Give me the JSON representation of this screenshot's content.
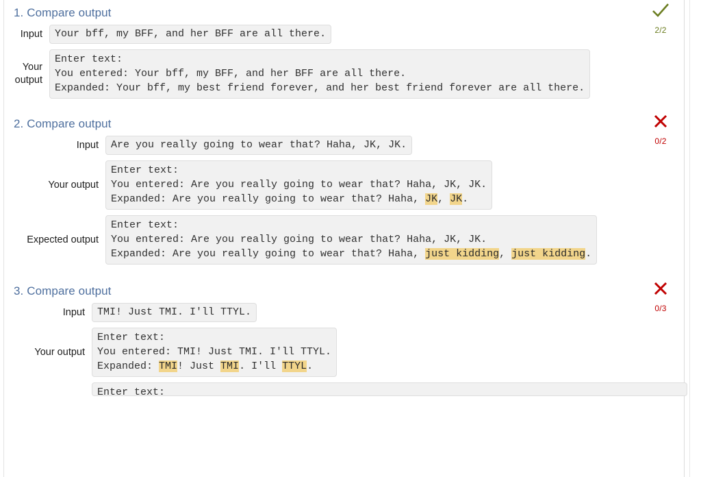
{
  "labels": {
    "input": "Input",
    "your_output": "Your output",
    "expected_output": "Expected output"
  },
  "sections": [
    {
      "title": "1. Compare output",
      "status_icon": "check-icon",
      "status": "pass",
      "score": "2/2",
      "input": "Your bff, my BFF, and her BFF are all there.",
      "your_output": {
        "line1": "Enter text:",
        "line2": "You entered: Your bff, my BFF, and her BFF are all there.",
        "line3": "Expanded: Your bff, my best friend forever, and her best friend forever are all there."
      }
    },
    {
      "title": "2. Compare output",
      "status_icon": "cross-icon",
      "status": "fail",
      "score": "0/2",
      "input": "Are you really going to wear that? Haha, JK, JK.",
      "your_output": {
        "line1": "Enter text:",
        "line2": "You entered: Are you really going to wear that? Haha, JK, JK.",
        "line3_prefix": "Expanded: Are you really going to wear that? Haha, ",
        "line3_hl1": "JK",
        "line3_mid": ", ",
        "line3_hl2": "JK",
        "line3_suffix": "."
      },
      "expected_output": {
        "line1": "Enter text:",
        "line2": "You entered: Are you really going to wear that? Haha, JK, JK.",
        "line3_prefix": "Expanded: Are you really going to wear that? Haha, ",
        "line3_hl1": "just kidding",
        "line3_mid": ", ",
        "line3_hl2": "just kidding",
        "line3_suffix": "."
      }
    },
    {
      "title": "3. Compare output",
      "status_icon": "cross-icon",
      "status": "fail",
      "score": "0/3",
      "input": "TMI! Just TMI. I'll TTYL.",
      "your_output": {
        "line1": "Enter text:",
        "line2": "You entered: TMI! Just TMI. I'll TTYL.",
        "line3_prefix": "Expanded: ",
        "line3_hl1": "TMI",
        "line3_mid1": "! Just ",
        "line3_hl2": "TMI",
        "line3_mid2": ". I'll ",
        "line3_hl3": "TTYL",
        "line3_suffix": "."
      },
      "expected_output": {
        "line1": "Enter text:"
      }
    }
  ],
  "colors": {
    "heading": "#4e6f9e",
    "pass": "#6b7d20",
    "fail": "#c00000",
    "highlight": "#f2d58b",
    "box_bg": "#f1f1f1",
    "box_border": "#dedede"
  }
}
